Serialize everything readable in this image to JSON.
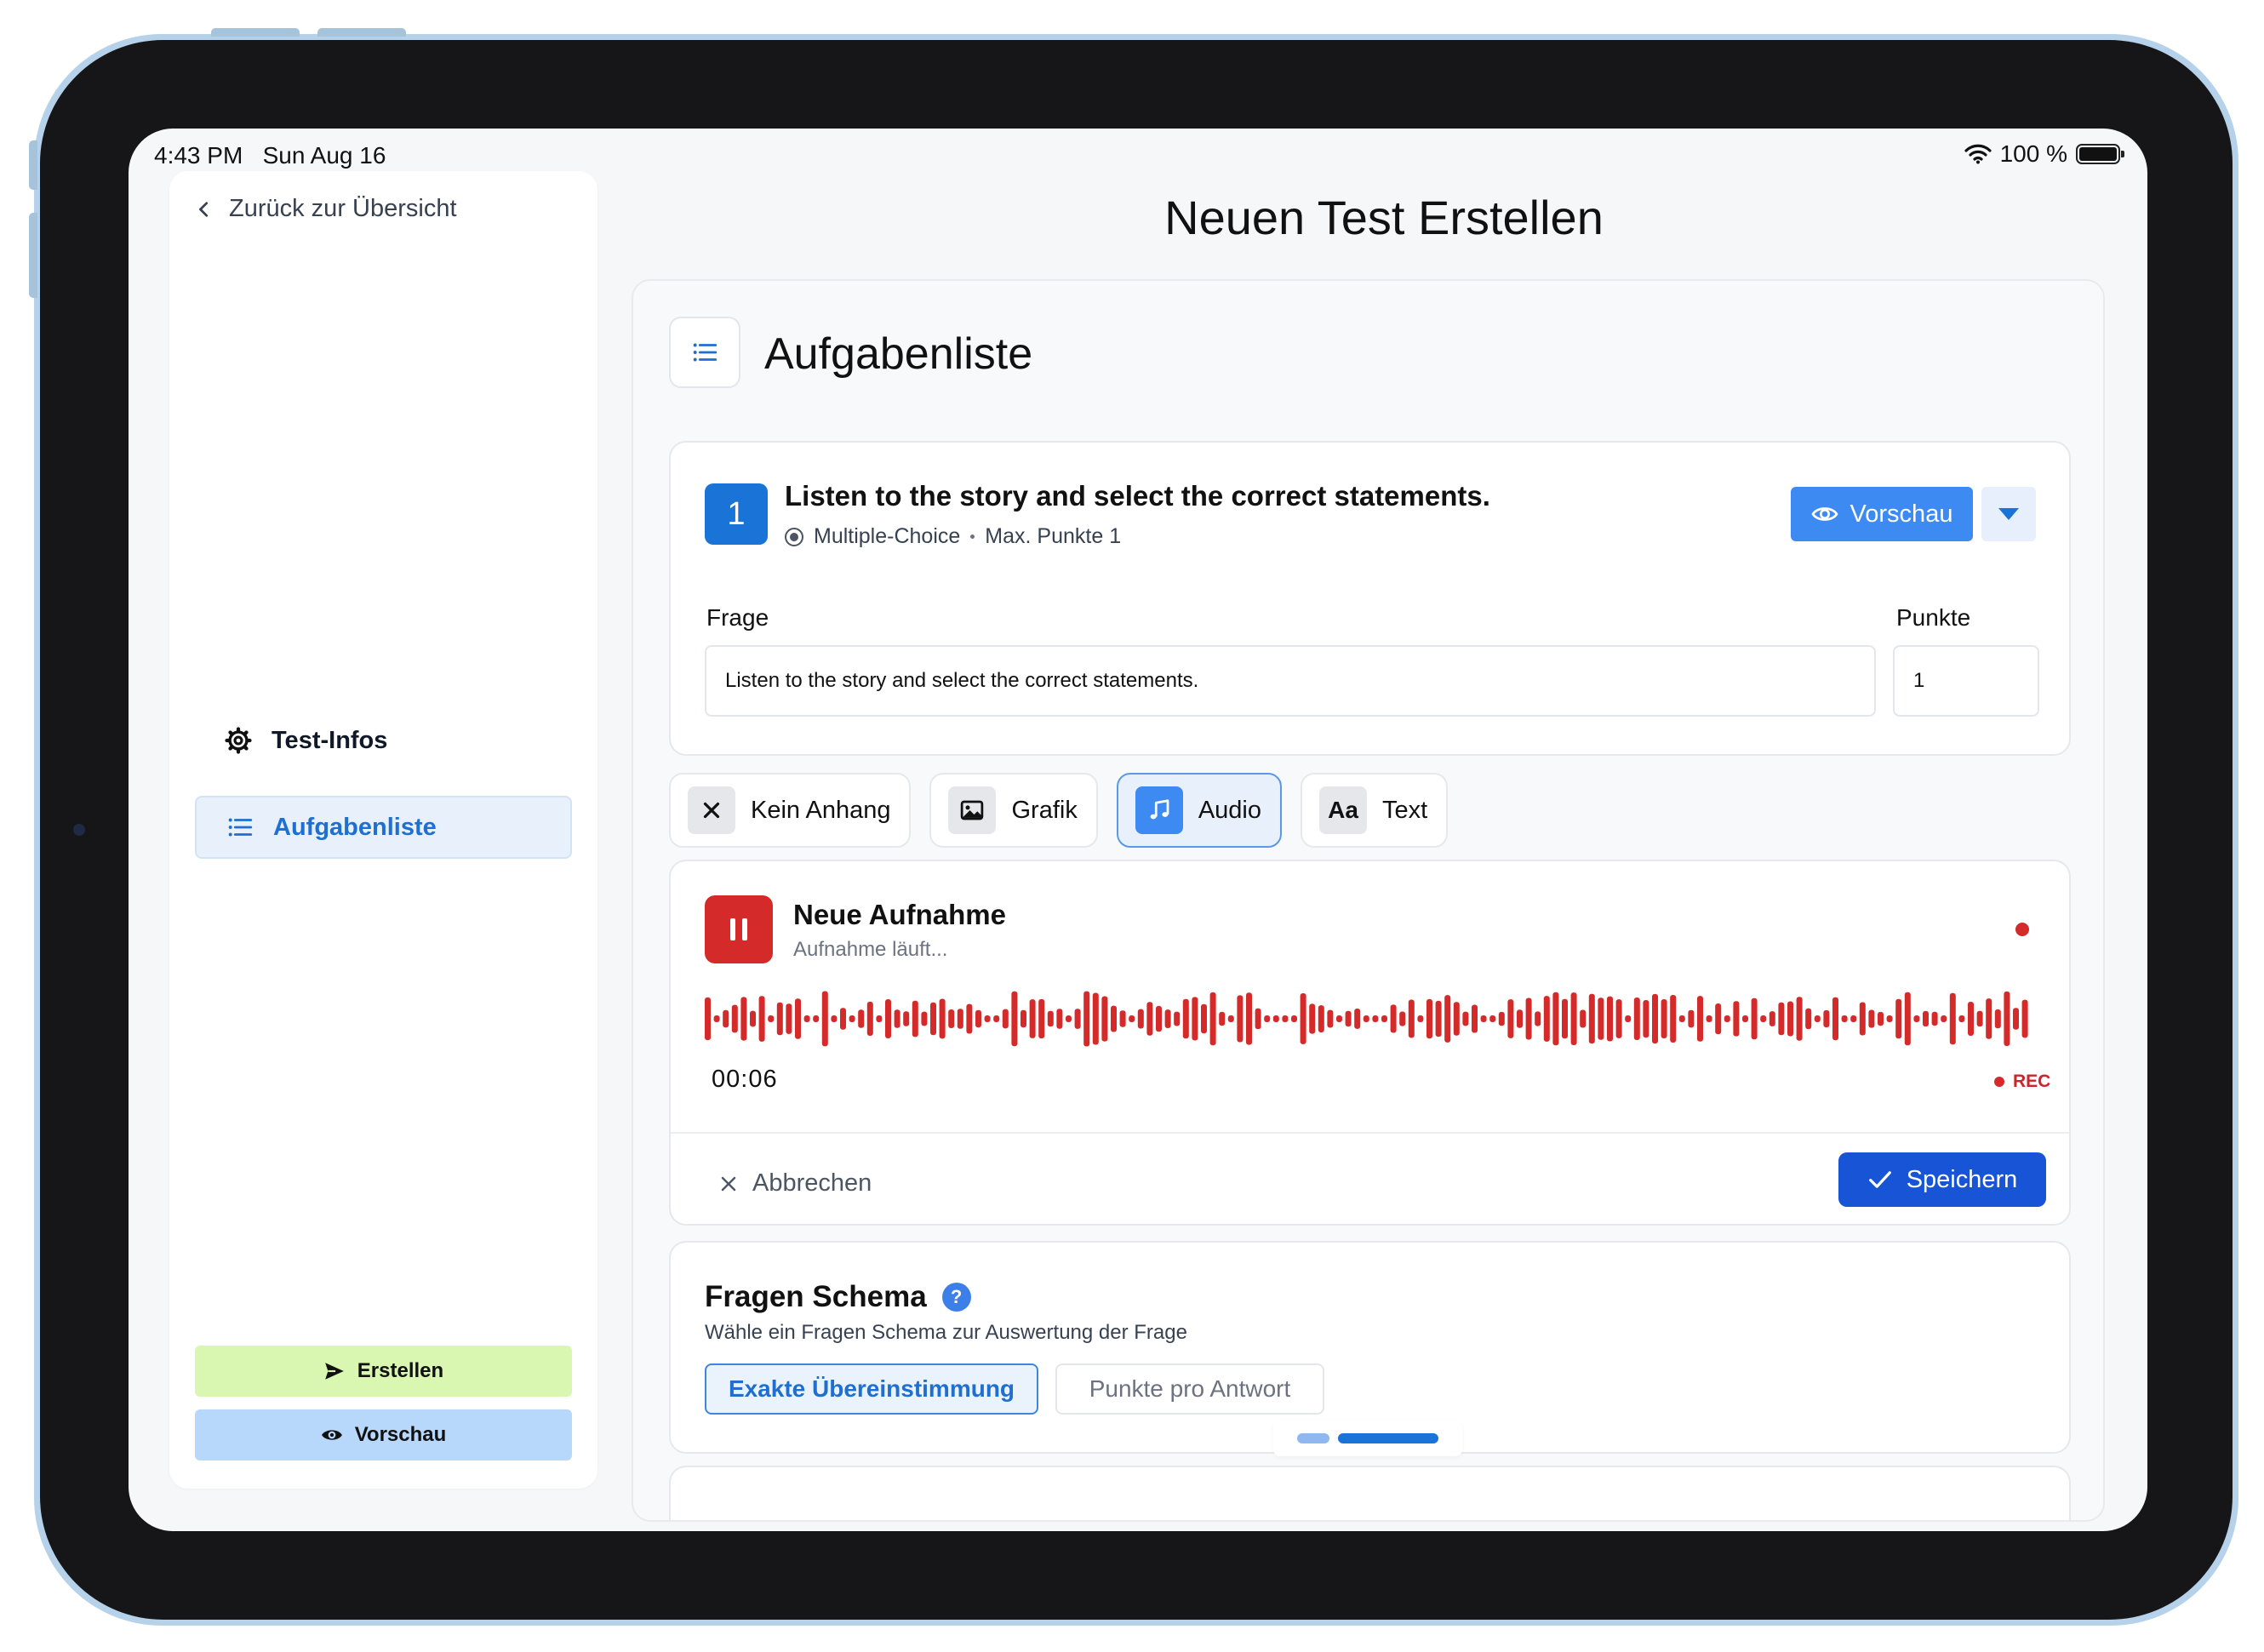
{
  "status_bar": {
    "time": "4:43 PM",
    "date": "Sun Aug 16",
    "battery": "100 %"
  },
  "sidebar": {
    "back_label": "Zurück zur Übersicht",
    "nav": [
      {
        "label": "Test-Infos",
        "icon": "gear-icon",
        "active": false
      },
      {
        "label": "Aufgabenliste",
        "icon": "list-icon",
        "active": true
      }
    ],
    "create_label": "Erstellen",
    "preview_label": "Vorschau"
  },
  "page": {
    "title": "Neuen Test Erstellen"
  },
  "section": {
    "title": "Aufgabenliste"
  },
  "task": {
    "number": "1",
    "title": "Listen to the story and select the correct statements.",
    "type": "Multiple-Choice",
    "max_points": "Max. Punkte 1",
    "preview_label": "Vorschau",
    "question_label": "Frage",
    "question_value": "Listen to the story and select the correct statements.",
    "points_label": "Punkte",
    "points_value": "1"
  },
  "attachments": {
    "options": [
      {
        "label": "Kein Anhang",
        "icon": "close-icon"
      },
      {
        "label": "Grafik",
        "icon": "image-icon"
      },
      {
        "label": "Audio",
        "icon": "music-note-icon"
      },
      {
        "label": "Text",
        "icon": "text-aa-icon",
        "glyph": "Aa"
      }
    ],
    "selected": "Audio"
  },
  "recording": {
    "title": "Neue Aufnahme",
    "status": "Aufnahme läuft...",
    "elapsed": "00:06",
    "rec_label": "REC",
    "cancel_label": "Abbrechen",
    "save_label": "Speichern",
    "waveform_color": "#d42a2a"
  },
  "schema": {
    "title": "Fragen Schema",
    "help_glyph": "?",
    "subtitle": "Wähle ein Fragen Schema zur Auswertung der Frage",
    "options": [
      "Exakte Übereinstimmung",
      "Punkte pro Antwort"
    ],
    "selected": "Exakte Übereinstimmung"
  },
  "colors": {
    "accent": "#1a73d6",
    "record": "#d42a2a",
    "save": "#1754d6",
    "create": "#d9f7b0",
    "preview": "#b7d8fb"
  }
}
